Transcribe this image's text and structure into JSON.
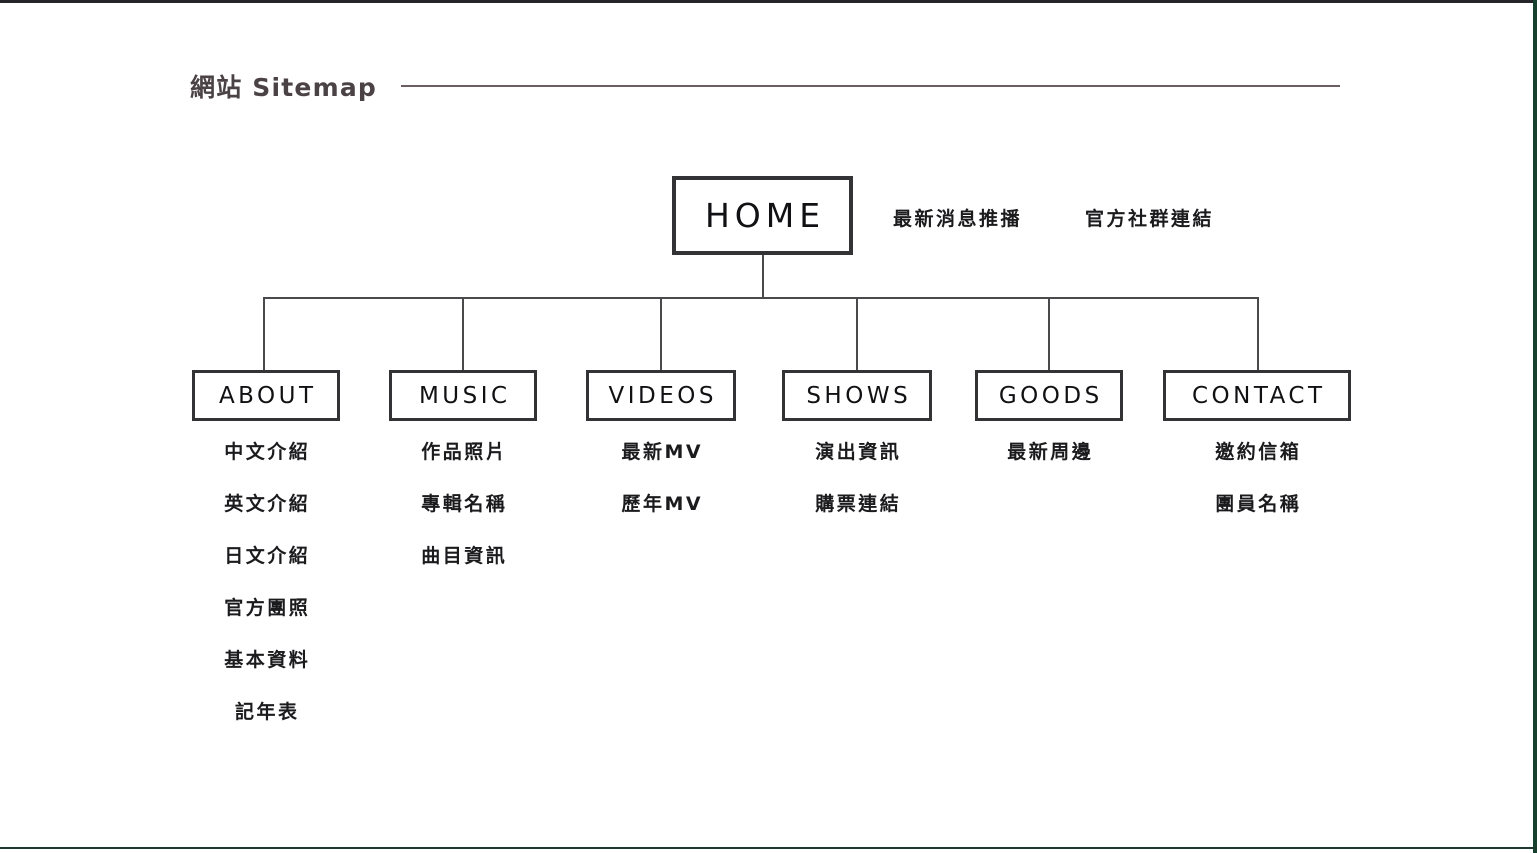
{
  "page": {
    "title": "網站 Sitemap",
    "frame_color": "#26262a",
    "frame_accent_color": "#17402f",
    "rule_color": "#6b5d60",
    "box_border_color": "#333336",
    "connector_color": "#4a4a4c",
    "background": "#ffffff"
  },
  "root": {
    "label": "HOME",
    "extras": [
      {
        "label": "最新消息推播"
      },
      {
        "label": "官方社群連結"
      }
    ]
  },
  "sections": [
    {
      "label": "ABOUT",
      "children": [
        {
          "label": "中文介紹"
        },
        {
          "label": "英文介紹"
        },
        {
          "label": "日文介紹"
        },
        {
          "label": "官方團照"
        },
        {
          "label": "基本資料"
        },
        {
          "label": "記年表"
        }
      ]
    },
    {
      "label": "MUSIC",
      "children": [
        {
          "label": "作品照片"
        },
        {
          "label": "專輯名稱"
        },
        {
          "label": "曲目資訊"
        }
      ]
    },
    {
      "label": "VIDEOS",
      "children": [
        {
          "label": "最新MV"
        },
        {
          "label": "歷年MV"
        }
      ]
    },
    {
      "label": "SHOWS",
      "children": [
        {
          "label": "演出資訊"
        },
        {
          "label": "購票連結"
        }
      ]
    },
    {
      "label": "GOODS",
      "children": [
        {
          "label": "最新周邊"
        }
      ]
    },
    {
      "label": "CONTACT",
      "children": [
        {
          "label": "邀約信箱"
        },
        {
          "label": "團員名稱"
        }
      ]
    }
  ]
}
